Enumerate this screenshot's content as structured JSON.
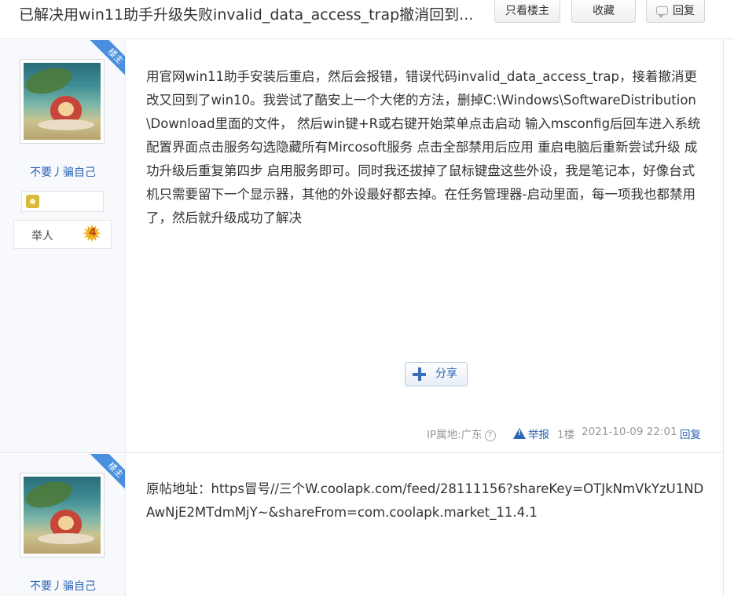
{
  "thread": {
    "title": "已解决用win11助手升级失败invalid_data_access_trap撤消回到...",
    "btn_only_op": "只看楼主",
    "btn_favorite": "收藏",
    "btn_reply": "回复"
  },
  "posts": [
    {
      "ribbon": "楼主",
      "username": "不要丿骗自己",
      "level_name": "举人",
      "level_num": "4",
      "content": "用官网win11助手安装后重启，然后会报错，错误代码invalid_data_access_trap，接着撤消更改又回到了win10。我尝试了酷安上一个大佬的方法，删掉C:\\Windows\\SoftwareDistribution\\Download里面的文件，  然后win键+R或右键开始菜单点击启动 输入msconfig后回车进入系统配置界面点击服务勾选隐藏所有Mircosoft服务 点击全部禁用后应用 重启电脑后重新尝试升级 成功升级后重复第四步 启用服务即可。同时我还拔掉了鼠标键盘这些外设，我是笔记本，好像台式机只需要留下一个显示器，其他的外设最好都去掉。在任务管理器-启动里面，每一项我也都禁用了，然后就升级成功了解决",
      "share_label": "分享",
      "ip": "IP属地:广东",
      "report": "举报",
      "floor": "1楼",
      "time": "2021-10-09 22:01",
      "reply": "回复"
    },
    {
      "ribbon": "楼主",
      "username": "不要丿骗自己",
      "content": "原帖地址：https冒号//三个W.coolapk.com/feed/28111156?shareKey=OTJkNmVkYzU1NDAwNjE2MTdmMjY~&shareFrom=com.coolapk.market_11.4.1"
    }
  ]
}
